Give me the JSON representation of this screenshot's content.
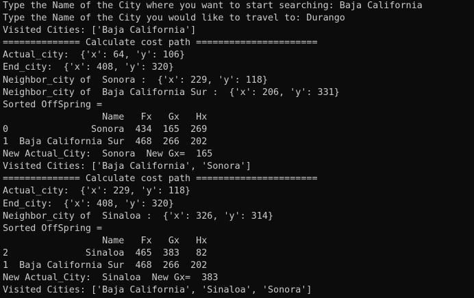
{
  "terminal": {
    "foreground": "#cccccc",
    "background": "#0c0c0c",
    "lines": [
      "Type the Name of the City where you want to start searching: Baja California",
      "Type the Name of the City you would like to travel to: Durango",
      "Visited Cities: ['Baja California']",
      "============== Calculate cost path ======================",
      "Actual_city:  {'x': 64, 'y': 106}",
      "End_city:  {'x': 408, 'y': 320}",
      "Neighbor_city of  Sonora :  {'x': 229, 'y': 118}",
      "Neighbor_city of  Baja California Sur :  {'x': 206, 'y': 331}",
      "Sorted OffSpring =",
      "                  Name   Fx   Gx   Hx",
      "0               Sonora  434  165  269",
      "1  Baja California Sur  468  266  202",
      "New Actual_City:  Sonora  New Gx=  165",
      "Visited Cities: ['Baja California', 'Sonora']",
      "============== Calculate cost path ======================",
      "Actual_city:  {'x': 229, 'y': 118}",
      "End_city:  {'x': 408, 'y': 320}",
      "Neighbor_city of  Sinaloa :  {'x': 326, 'y': 314}",
      "Sorted OffSpring =",
      "                  Name   Fx   Gx   Hx",
      "2              Sinaloa  465  383   82",
      "1  Baja California Sur  468  266  202",
      "New Actual_City:  Sinaloa  New Gx=  383",
      "Visited Cities: ['Baja California', 'Sinaloa', 'Sonora']"
    ]
  }
}
